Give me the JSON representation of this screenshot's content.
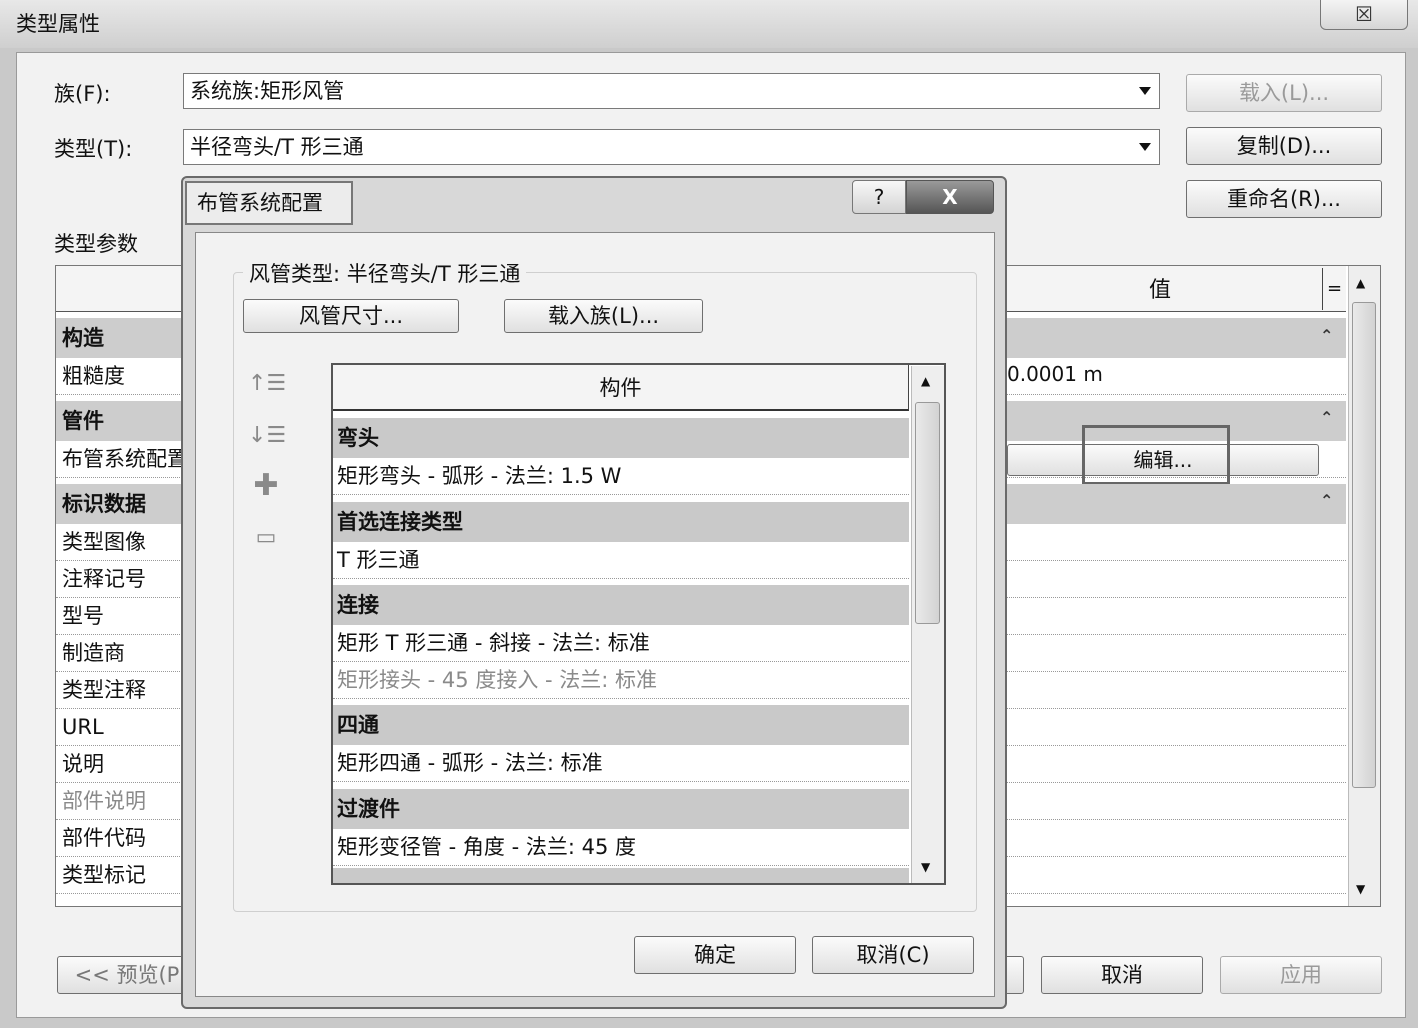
{
  "window": {
    "title": "类型属性",
    "close_glyph": "☒"
  },
  "family": {
    "label": "族(F):",
    "value": "系统族:矩形风管"
  },
  "type": {
    "label": "类型(T):",
    "value": "半径弯头/T 形三通"
  },
  "buttons": {
    "load": "载入(L)...",
    "duplicate": "复制(D)...",
    "rename": "重命名(R)...",
    "preview": "<< 预览(P",
    "ok_hidden": "",
    "cancel": "取消",
    "apply": "应用"
  },
  "type_params": {
    "label": "类型参数",
    "value_header": "值",
    "eq_header": "=",
    "groups": [
      {
        "name": "构造"
      },
      {
        "name": "管件"
      },
      {
        "name": "标识数据"
      }
    ],
    "rows": {
      "roughness": {
        "name": "粗糙度",
        "value": "0.0001 m"
      },
      "routing": {
        "name": "布管系统配置",
        "value": "编辑..."
      },
      "identity": [
        "类型图像",
        "注释记号",
        "型号",
        "制造商",
        "类型注释",
        "URL",
        "说明",
        "部件说明",
        "部件代码",
        "类型标记"
      ]
    }
  },
  "dialog": {
    "title": "布管系统配置",
    "help": "?",
    "close": "X",
    "duct_type_label": "风管类型: 半径弯头/T 形三通",
    "duct_sizes_button": "风管尺寸...",
    "load_family_button": "载入族(L)...",
    "list_header": "构件",
    "groups": [
      {
        "name": "弯头",
        "items": [
          "矩形弯头 - 弧形 - 法兰: 1.5 W"
        ]
      },
      {
        "name": "首选连接类型",
        "items": [
          "T 形三通"
        ]
      },
      {
        "name": "连接",
        "items": [
          "矩形 T 形三通 - 斜接 - 法兰: 标准",
          "矩形接头 - 45 度接入 - 法兰: 标准"
        ]
      },
      {
        "name": "四通",
        "items": [
          "矩形四通 - 弧形 - 法兰: 标准"
        ]
      },
      {
        "name": "过渡件",
        "items": [
          "矩形变径管 - 角度 - 法兰: 45 度"
        ]
      }
    ],
    "ok_button": "确定",
    "cancel_button": "取消(C)"
  },
  "icons": [
    "move-up-icon",
    "move-down-icon",
    "add-icon",
    "remove-icon"
  ]
}
